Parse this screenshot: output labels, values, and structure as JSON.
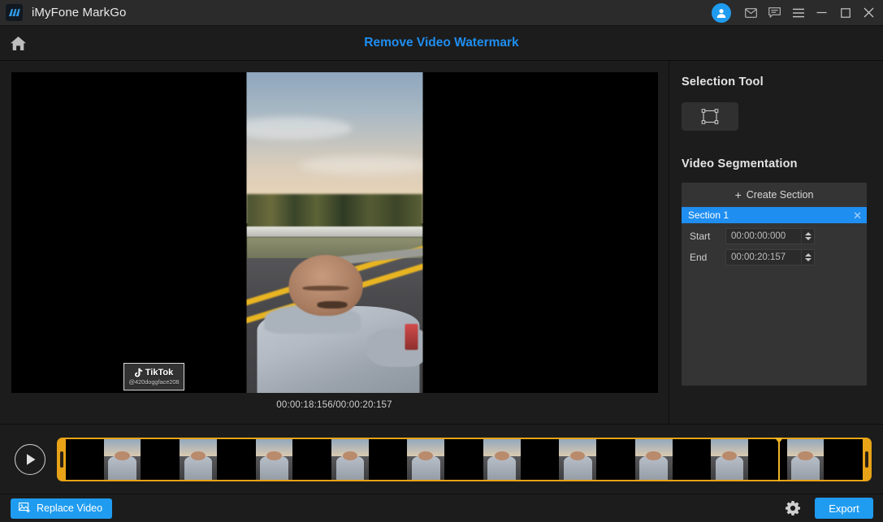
{
  "titlebar": {
    "app_name": "iMyFone MarkGo",
    "logo_icon": "markgo-logo-icon",
    "avatar_icon": "user-avatar-icon",
    "mail_icon": "mail-icon",
    "feedback_icon": "feedback-chat-icon",
    "menu_icon": "hamburger-menu-icon",
    "minimize_icon": "minimize-icon",
    "maximize_icon": "maximize-icon",
    "close_icon": "close-icon",
    "accent_color": "#1f9cf0",
    "bg_color": "#2b2b2b"
  },
  "navbar": {
    "home_icon": "home-icon",
    "page_title": "Remove Video Watermark",
    "title_color": "#1f8ef1"
  },
  "preview": {
    "timecode": "00:00:18:156/00:00:20:157",
    "watermark": {
      "brand": "TikTok",
      "note_icon": "tiktok-note-icon",
      "username": "@420doggface208"
    }
  },
  "side_panel": {
    "selection_tool": {
      "heading": "Selection Tool",
      "button_icon": "selection-rectangle-icon"
    },
    "video_segmentation": {
      "heading": "Video Segmentation",
      "create_label": "Create Section",
      "create_plus": "+",
      "sections": [
        {
          "name": "Section 1",
          "close_icon": "close-icon",
          "start_label": "Start",
          "start_value": "00:00:00:000",
          "end_label": "End",
          "end_value": "00:00:20:157"
        }
      ],
      "highlight_color": "#1f8ef1"
    }
  },
  "timeline": {
    "play_icon": "play-icon",
    "strip_color": "#e8a317",
    "playhead_color": "#f0b429",
    "playhead_position_pct": 88.5,
    "frames": [
      {
        "type": "black"
      },
      {
        "type": "frame"
      },
      {
        "type": "black"
      },
      {
        "type": "frame"
      },
      {
        "type": "black"
      },
      {
        "type": "frame"
      },
      {
        "type": "black"
      },
      {
        "type": "frame"
      },
      {
        "type": "black"
      },
      {
        "type": "frame"
      },
      {
        "type": "black"
      },
      {
        "type": "frame"
      },
      {
        "type": "black"
      },
      {
        "type": "frame"
      },
      {
        "type": "black"
      },
      {
        "type": "frame"
      },
      {
        "type": "black"
      },
      {
        "type": "frame"
      },
      {
        "type": "black"
      },
      {
        "type": "frame"
      },
      {
        "type": "black"
      }
    ]
  },
  "footer": {
    "replace_label": "Replace Video",
    "replace_icon": "image-add-icon",
    "gear_icon": "gear-icon",
    "export_label": "Export",
    "accent_color": "#1f9cf0"
  }
}
